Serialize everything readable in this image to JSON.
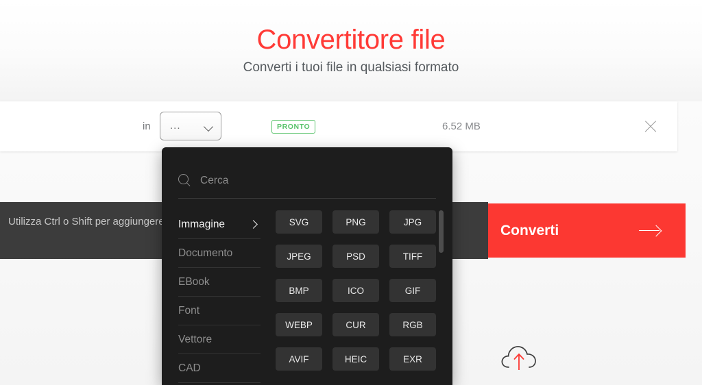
{
  "header": {
    "title": "Convertitore file",
    "subtitle": "Converti i tuoi file in qualsiasi formato",
    "title_color": "#ff3a36"
  },
  "file_row": {
    "in_label": "in",
    "format_value": "...",
    "chevron_icon": "chevron-down-icon",
    "status_badge": "PRONTO",
    "status_color": "#58c26a",
    "file_size": "6.52 MB",
    "close_icon": "close-icon"
  },
  "tooltip": {
    "text": "Utilizza Ctrl o Shift per aggiungere più file contemporaneamente"
  },
  "convert": {
    "label": "Converti",
    "arrow_icon": "arrow-right-icon",
    "color": "#fc3832"
  },
  "upload": {
    "icon": "cloud-upload-icon",
    "arrow_color": "#fc3832"
  },
  "dropdown": {
    "search": {
      "icon": "search-icon",
      "placeholder": "Cerca",
      "value": ""
    },
    "categories": [
      {
        "label": "Immagine",
        "active": true,
        "chevron_icon": "chevron-right-icon"
      },
      {
        "label": "Documento",
        "active": false
      },
      {
        "label": "EBook",
        "active": false
      },
      {
        "label": "Font",
        "active": false
      },
      {
        "label": "Vettore",
        "active": false
      },
      {
        "label": "CAD",
        "active": false
      }
    ],
    "formats": [
      "SVG",
      "PNG",
      "JPG",
      "JPEG",
      "PSD",
      "TIFF",
      "BMP",
      "ICO",
      "GIF",
      "WEBP",
      "CUR",
      "RGB",
      "AVIF",
      "HEIC",
      "EXR"
    ],
    "scrollbar": {
      "position": "top"
    }
  }
}
